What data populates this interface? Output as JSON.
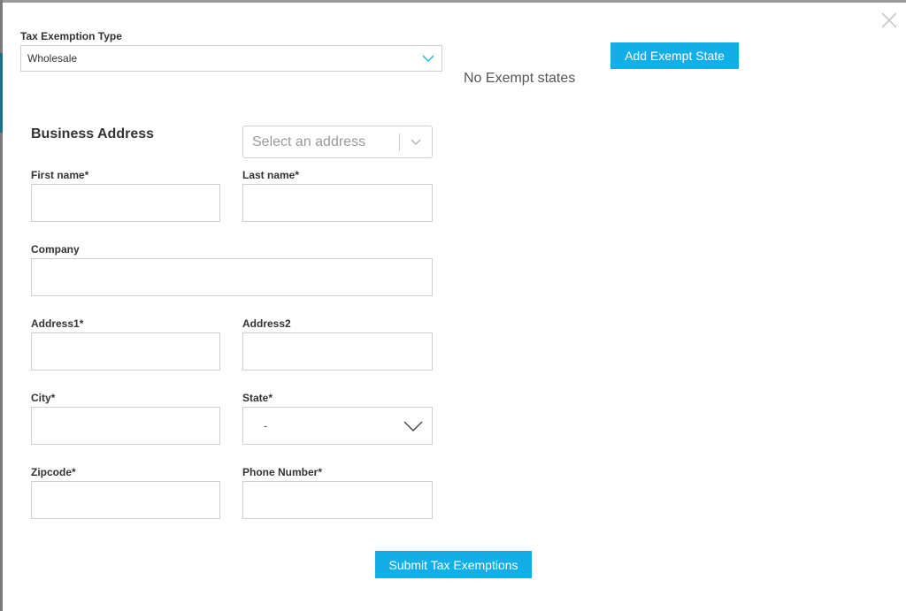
{
  "tax_exemption": {
    "label": "Tax Exemption Type",
    "selected_value": "Wholesale"
  },
  "exempt_states": {
    "add_button_label": "Add Exempt State",
    "empty_text": "No Exempt states"
  },
  "business_address": {
    "title": "Business Address",
    "address_select_placeholder": "Select an address",
    "fields": {
      "first_name_label": "First name*",
      "last_name_label": "Last name*",
      "company_label": "Company",
      "address1_label": "Address1*",
      "address2_label": "Address2",
      "city_label": "City*",
      "state_label": "State*",
      "state_value": "-",
      "zipcode_label": "Zipcode*",
      "phone_label": "Phone Number*"
    }
  },
  "submit_button_label": "Submit Tax Exemptions",
  "icons": {
    "close": "close-icon",
    "chevron": "chevron-down-icon"
  },
  "colors": {
    "accent": "#12aee8",
    "border": "#cfcfcf",
    "text": "#333333"
  }
}
